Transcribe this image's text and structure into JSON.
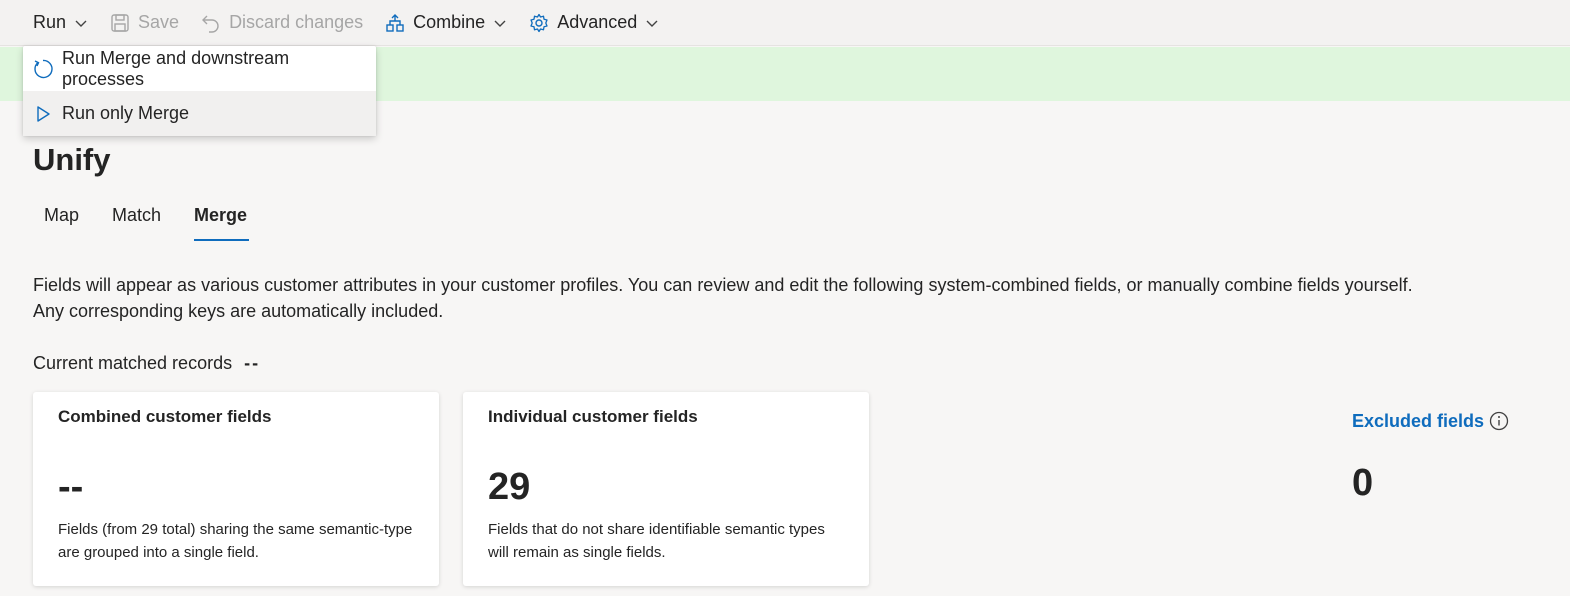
{
  "toolbar": {
    "run_label": "Run",
    "save_label": "Save",
    "discard_label": "Discard changes",
    "combine_label": "Combine",
    "advanced_label": "Advanced"
  },
  "run_menu": {
    "items": [
      {
        "label": "Run Merge and downstream processes",
        "icon": "refresh-icon"
      },
      {
        "label": "Run only Merge",
        "icon": "play-icon"
      }
    ]
  },
  "page": {
    "title": "Unify",
    "tabs": [
      {
        "label": "Map",
        "active": false
      },
      {
        "label": "Match",
        "active": false
      },
      {
        "label": "Merge",
        "active": true
      }
    ],
    "description": "Fields will appear as various customer attributes in your customer profiles. You can review and edit the following system-combined fields, or manually combine fields yourself. Any corresponding keys are automatically included.",
    "matched_label": "Current matched records",
    "matched_value": "--"
  },
  "cards": [
    {
      "title": "Combined customer fields",
      "value": "--",
      "description": "Fields (from 29 total) sharing the same semantic-type are grouped into a single field."
    },
    {
      "title": "Individual customer fields",
      "value": "29",
      "description": "Fields that do not share identifiable semantic types will remain as single fields."
    }
  ],
  "excluded": {
    "label": "Excluded fields",
    "value": "0"
  },
  "colors": {
    "accent": "#0f6cbd",
    "banner": "#dff6dd",
    "toolbar_bg": "#f3f2f1",
    "page_bg": "#f7f6f5"
  }
}
